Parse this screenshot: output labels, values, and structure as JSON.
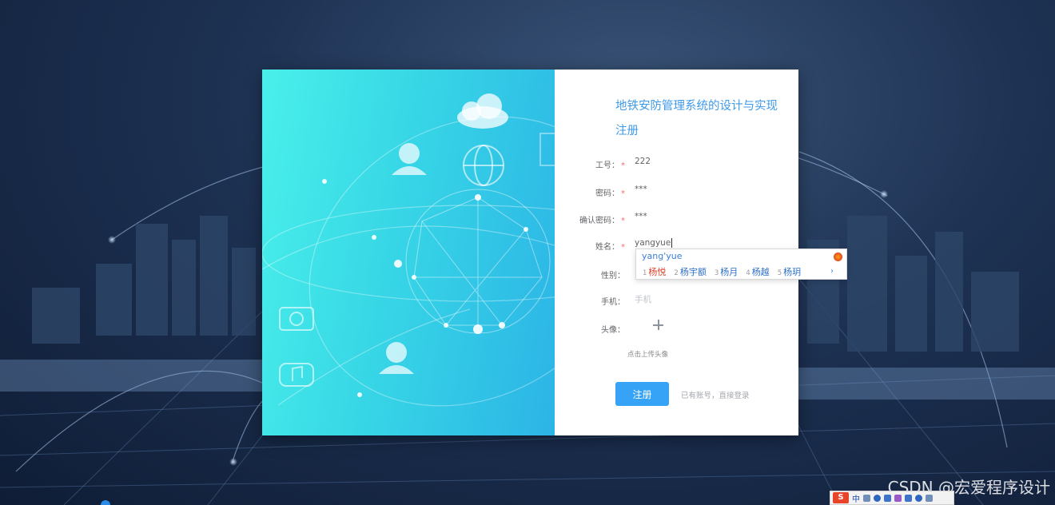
{
  "form": {
    "title": "地铁安防管理系统的设计与实现注册",
    "fields": [
      {
        "label": "工号：",
        "required": true,
        "value": "222"
      },
      {
        "label": "密码：",
        "required": true,
        "value": "***"
      },
      {
        "label": "确认密码：",
        "required": true,
        "value": "***"
      },
      {
        "label": "姓名：",
        "required": true,
        "value": "yangyue"
      },
      {
        "label": "性别：",
        "required": false,
        "value": ""
      },
      {
        "label": "手机：",
        "required": false,
        "placeholder": "手机"
      },
      {
        "label": "头像：",
        "required": false,
        "value": ""
      }
    ],
    "required_mark": "*",
    "upload_hint": "点击上传头像",
    "register_label": "注册",
    "login_link": "已有账号，直接登录"
  },
  "ime": {
    "composition": "yang'yue",
    "candidates": [
      {
        "num": "1",
        "text": "杨悦"
      },
      {
        "num": "2",
        "text": "杨宇额"
      },
      {
        "num": "3",
        "text": "杨月"
      },
      {
        "num": "4",
        "text": "杨越"
      },
      {
        "num": "5",
        "text": "杨玥"
      }
    ],
    "next_symbol": "›"
  },
  "taskbar": {
    "ime_logo": "S",
    "ime_mode": "中"
  },
  "watermark": "CSDN @宏爱程序设计",
  "colors": {
    "accent": "#36a3f7",
    "title": "#3f9ae8",
    "required": "#f56c6c",
    "panel_left_start": "#49f0ea",
    "panel_left_end": "#2cb4e6"
  }
}
